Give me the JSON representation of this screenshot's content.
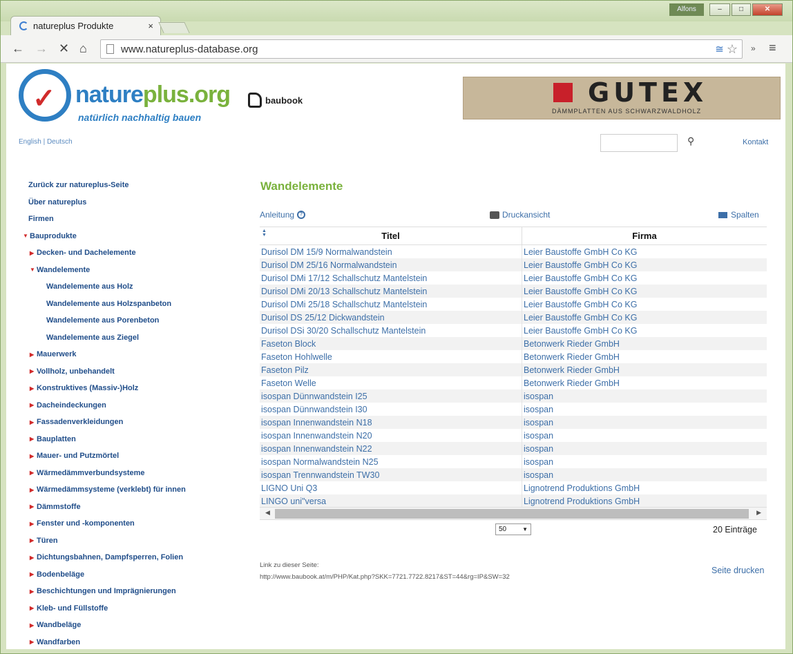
{
  "browser": {
    "tab_title": "natureplus Produkte",
    "tab_close": "×",
    "user_badge": "Alfons",
    "url": "www.natureplus-database.org",
    "min": "–",
    "max": "□",
    "close": "✕",
    "back": "←",
    "forward": "→",
    "stop": "✕",
    "home": "⌂",
    "star": "☆",
    "ext": "≅",
    "more": "»",
    "menu": "≡"
  },
  "header": {
    "brand_nature": "nature",
    "brand_plus": "plus.org",
    "tagline": "natürlich nachhaltig bauen",
    "baubook": "baubook",
    "banner_title": "GUTEX",
    "banner_sub": "DÄMMPLATTEN AUS SCHWARZWALDHOLZ",
    "lang": "English | Deutsch",
    "search_icon": "⚲",
    "contact": "Kontakt"
  },
  "sidebar": {
    "items": [
      {
        "label": "Zurück zur natureplus-Seite"
      },
      {
        "label": "Über natureplus"
      },
      {
        "label": "Firmen"
      },
      {
        "label": "Bauprodukte"
      },
      {
        "label": "Decken- und Dachelemente"
      },
      {
        "label": "Wandelemente"
      },
      {
        "label": "Wandelemente aus Holz"
      },
      {
        "label": "Wandelemente aus Holzspanbeton"
      },
      {
        "label": "Wandelemente aus Porenbeton"
      },
      {
        "label": "Wandelemente aus Ziegel"
      },
      {
        "label": "Mauerwerk"
      },
      {
        "label": "Vollholz, unbehandelt"
      },
      {
        "label": "Konstruktives (Massiv-)Holz"
      },
      {
        "label": "Dacheindeckungen"
      },
      {
        "label": "Fassadenverkleidungen"
      },
      {
        "label": "Bauplatten"
      },
      {
        "label": "Mauer- und Putzmörtel"
      },
      {
        "label": "Wärmedämmverbundsysteme"
      },
      {
        "label": "Wärmedämmsysteme (verklebt) für innen"
      },
      {
        "label": "Dämmstoffe"
      },
      {
        "label": "Fenster und -komponenten"
      },
      {
        "label": "Türen"
      },
      {
        "label": "Dichtungsbahnen, Dampfsperren, Folien"
      },
      {
        "label": "Bodenbeläge"
      },
      {
        "label": "Beschichtungen und Imprägnierungen"
      },
      {
        "label": "Kleb- und Füllstoffe"
      },
      {
        "label": "Wandbeläge"
      },
      {
        "label": "Wandfarben"
      }
    ]
  },
  "main": {
    "title": "Wandelemente",
    "help_link": "Anleitung",
    "help_icon": "?",
    "print_view": "Druckansicht",
    "columns": "Spalten",
    "col_title": "Titel",
    "col_company": "Firma",
    "rows": [
      [
        "Durisol DM 15/9 Normalwandstein",
        "Leier Baustoffe GmbH  Co KG"
      ],
      [
        "Durisol DM 25/16 Normalwandstein",
        "Leier Baustoffe GmbH  Co KG"
      ],
      [
        "Durisol DMi 17/12 Schallschutz Mantelstein",
        "Leier Baustoffe GmbH  Co KG"
      ],
      [
        "Durisol DMi 20/13 Schallschutz Mantelstein",
        "Leier Baustoffe GmbH  Co KG"
      ],
      [
        "Durisol DMi 25/18 Schallschutz Mantelstein",
        "Leier Baustoffe GmbH  Co KG"
      ],
      [
        "Durisol DS 25/12 Dickwandstein",
        "Leier Baustoffe GmbH  Co KG"
      ],
      [
        "Durisol DSi 30/20 Schallschutz Mantelstein",
        "Leier Baustoffe GmbH  Co KG"
      ],
      [
        "Faseton Block",
        "Betonwerk Rieder GmbH"
      ],
      [
        "Faseton Hohlwelle",
        "Betonwerk Rieder GmbH"
      ],
      [
        "Faseton Pilz",
        "Betonwerk Rieder GmbH"
      ],
      [
        "Faseton Welle",
        "Betonwerk Rieder GmbH"
      ],
      [
        "isospan Dünnwandstein I25",
        "isospan"
      ],
      [
        "isospan Dünnwandstein I30",
        "isospan"
      ],
      [
        "isospan Innenwandstein N18",
        "isospan"
      ],
      [
        "isospan Innenwandstein N20",
        "isospan"
      ],
      [
        "isospan Innenwandstein N22",
        "isospan"
      ],
      [
        "isospan Normalwandstein N25",
        "isospan"
      ],
      [
        "isospan Trennwandstein TW30",
        "isospan"
      ],
      [
        "LIGNO Uni Q3",
        "Lignotrend Produktions GmbH"
      ],
      [
        "LINGO uni\"versa",
        "Lignotrend Produktions GmbH"
      ]
    ],
    "page_size": "50",
    "entries": "20 Einträge",
    "link_label": "Link zu dieser Seite:",
    "link_url": "http://www.baubook.at/m/PHP/Kat.php?SKK=7721.7722.8217&ST=44&rg=IP&SW=32",
    "print_page": "Seite drucken"
  }
}
